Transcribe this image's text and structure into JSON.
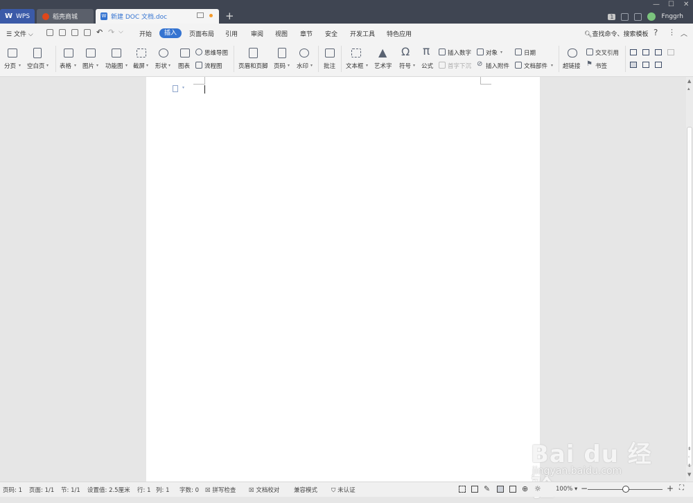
{
  "titlebar": {
    "tabs": [
      {
        "label": "WPS",
        "icon": "wps-logo-icon"
      },
      {
        "label": "稻壳商城",
        "icon": "docer-flame-icon"
      },
      {
        "label": "新建 DOC 文档.doc",
        "icon": "writer-doc-icon",
        "active": true
      }
    ],
    "new_tab": "+",
    "window_controls": [
      "—",
      "☐",
      "✕"
    ],
    "notification_count": "1",
    "user_name": "Fnggrh"
  },
  "menubar": {
    "file_label": "文件",
    "tabs": [
      "开始",
      "插入",
      "页面布局",
      "引用",
      "审阅",
      "视图",
      "章节",
      "安全",
      "开发工具",
      "特色应用"
    ],
    "active_tab": "插入",
    "search_label": "查找命令、搜索模板",
    "help": "?",
    "more": "⋮",
    "collapse": "︿"
  },
  "ribbon": {
    "page_break": "分页",
    "blank_page": "空白页",
    "table": "表格",
    "picture": "图片",
    "function_chart": "功能图",
    "screenshot": "截屏",
    "shape": "形状",
    "chart": "图表",
    "mind_map": "思维导图",
    "flowchart": "流程图",
    "header_footer": "页眉和页脚",
    "page_number": "页码",
    "watermark": "水印",
    "comment": "批注",
    "text_box": "文本框",
    "word_art": "艺术字",
    "symbol": "符号",
    "symbol_glyph": "Ω",
    "equation": "公式",
    "equation_glyph": "π",
    "insert_number": "插入数字",
    "drop_cap": "首字下沉",
    "object": "对象",
    "attachment": "插入附件",
    "date": "日期",
    "doc_parts": "文档部件",
    "hyperlink": "超链接",
    "cross_ref": "交叉引用",
    "bookmark": "书签"
  },
  "statusbar": {
    "page_num": "页码: 1",
    "pages": "页面: 1/1",
    "section": "节: 1/1",
    "setting": "设置值: 2.5厘米",
    "row": "行: 1",
    "col": "列: 1",
    "word_count": "字数: 0",
    "spell_check": "拼写检查",
    "doc_check": "文档校对",
    "compat_mode": "兼容模式",
    "unverified": "未认证",
    "zoom": "100%",
    "zoom_level": 0.5
  },
  "watermark": {
    "brand": "Bai du 经验",
    "url": "jingyan.baidu.com"
  }
}
